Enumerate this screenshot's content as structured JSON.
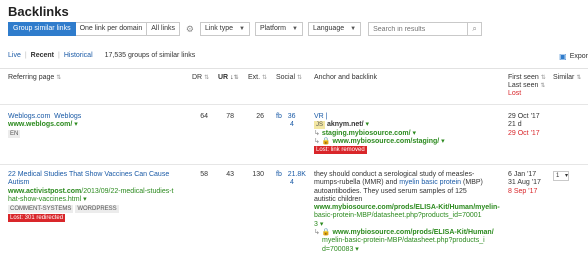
{
  "page": {
    "title": "Backlinks"
  },
  "toolbar": {
    "group_similar": "Group similar links",
    "one_per_domain": "One link per domain",
    "all_links": "All links",
    "link_type": "Link type",
    "platform": "Platform",
    "language": "Language",
    "search_placeholder": "Search in results"
  },
  "tabs": {
    "live": "Live",
    "recent": "Recent",
    "historical": "Historical",
    "summary": "17,535 groups of similar links"
  },
  "export": {
    "label": "Expor"
  },
  "columns": {
    "referring_page": "Referring page",
    "dr": "DR",
    "ur": "UR",
    "ext": "Ext.",
    "social": "Social",
    "anchor": "Anchor and backlink",
    "first_seen": "First seen",
    "last_seen": "Last seen",
    "lost": "Lost",
    "similar": "Similar"
  },
  "rows": [
    {
      "title": "Weblogs.com",
      "title_suffix": "Weblogs",
      "url": "www.weblogs.com/",
      "lang": "EN",
      "dr": "64",
      "ur": "78",
      "ext": "26",
      "fb": "fb",
      "fb_count": "36",
      "fb_sub": "4",
      "anchor_title": "VR |",
      "anchor_badge": "JS",
      "anchor_domain": "aknym.net/",
      "anchor_link1": "staging.mybiosource.com/",
      "anchor_link2": "www.mybiosource.com/staging/",
      "lost_badge": "Lost: link removed",
      "first_seen": "29 Oct '17",
      "duration": "21 d",
      "lost_date": "29 Oct '17"
    },
    {
      "title_l1": "22 Medical Studies That Show Vaccines Can Cause",
      "title_l2": "Autism",
      "url_l1_bold": "www.activistpost.com",
      "url_l1_rest": "/2013/09/22-medical-studies-t",
      "url_l2": "hat-show-vaccines.html",
      "tag1": "COMMENT-SYSTEMS",
      "tag2": "WORDPRESS",
      "lost_badge": "Lost: 301 redirected",
      "dr": "58",
      "ur": "43",
      "ext": "130",
      "fb": "fb",
      "fb_count": "21.8K",
      "fb_sub": "4",
      "text_l1": "they should conduct a serological study of measles-",
      "text_l2": "mumps-rubella (MMR) and",
      "text_l2_link": "myelin basic protein",
      "text_l2_end": "(MBP)",
      "text_l3": "autoantibodies. They used serum samples of 125",
      "text_l4": "autistic children",
      "link1_l1": "www.mybiosource.com/prods/ELISA-Kit/Human/myelin-",
      "link1_l2": "basic-protein-MBP/datasheet.php?products_id=70001",
      "link1_l3": "3",
      "link2_l1": "www.mybiosource.com/prods/ELISA-Kit/Human/",
      "link2_l2": "myelin-basic-protein-MBP/datasheet.php?products_i",
      "link2_l3": "d=700083",
      "first_seen": "6 Jan '17",
      "last_seen": "31 Aug '17",
      "lost_date": "8 Sep '17",
      "similar": "1"
    }
  ]
}
